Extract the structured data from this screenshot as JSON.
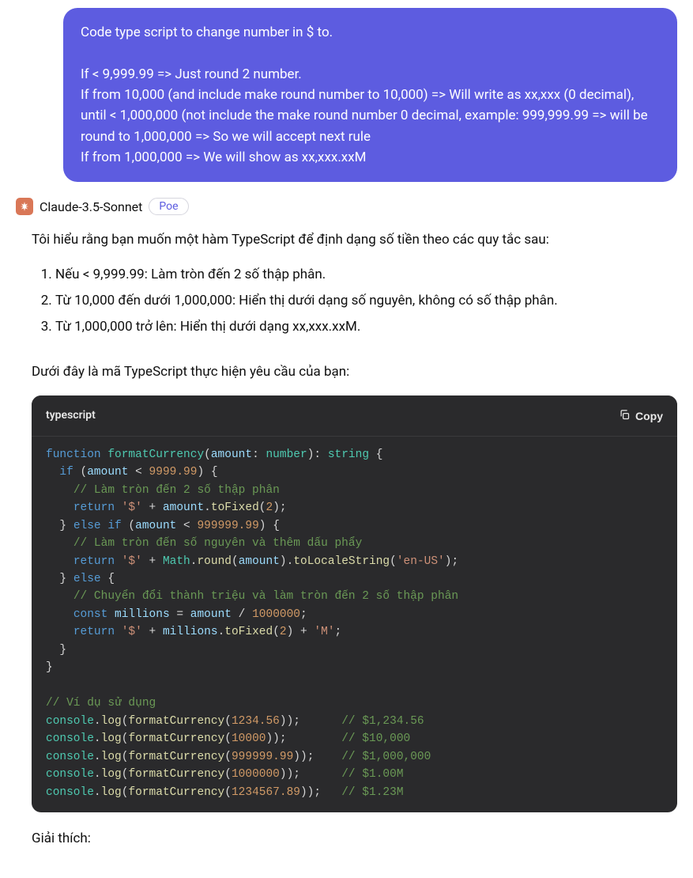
{
  "user_message": {
    "line1": "Code type script to change number in $ to.",
    "blank": "",
    "line2": "If < 9,999.99 => Just round 2 number.",
    "line3": "If from 10,000 (and include make round number to 10,000) => Will write as xx,xxx (0 decimal), until < 1,000,000 (not include the make round number 0 decimal, example: 999,999.99 => will be round to 1,000,000 => So we will accept next rule",
    "line4": "If from 1,000,000 => We will show as xx,xxx.xxM"
  },
  "bot": {
    "name": "Claude-3.5-Sonnet",
    "platform": "Poe"
  },
  "response": {
    "intro": "Tôi hiểu rằng bạn muốn một hàm TypeScript để định dạng số tiền theo các quy tắc sau:",
    "rules": [
      "Nếu < 9,999.99: Làm tròn đến 2 số thập phân.",
      "Từ 10,000 đến dưới 1,000,000: Hiển thị dưới dạng số nguyên, không có số thập phân.",
      "Từ 1,000,000 trở lên: Hiển thị dưới dạng xx,xxx.xxM."
    ],
    "code_intro": "Dưới đây là mã TypeScript thực hiện yêu cầu của bạn:",
    "outro": "Giải thích:"
  },
  "code": {
    "language": "typescript",
    "copy_label": "Copy",
    "tokens": {
      "kw_function": "function",
      "fn_name": "formatCurrency",
      "param": "amount",
      "typ_number": "number",
      "typ_string": "string",
      "kw_if": "if",
      "num_999999_1": "9999.99",
      "com1": "// Làm tròn đến 2 số thập phân",
      "kw_return": "return",
      "str_dollar": "'$'",
      "call_toFixed": "toFixed",
      "num_2": "2",
      "kw_elseif": "else if",
      "num_999999_99": "999999.99",
      "com2": "// Làm tròn đến số nguyên và thêm dấu phẩy",
      "obj_Math": "Math",
      "call_round": "round",
      "call_toLocale": "toLocaleString",
      "str_enus": "'en-US'",
      "kw_else": "else",
      "com3": "// Chuyển đổi thành triệu và làm tròn đến 2 số thập phân",
      "kw_const": "const",
      "var_millions": "millions",
      "num_million": "1000000",
      "str_M": "'M'",
      "com_vd": "// Ví dụ sử dụng",
      "obj_console": "console",
      "call_log": "log",
      "num_ex1": "1234.56",
      "com_ex1": "// $1,234.56",
      "num_ex2": "10000",
      "com_ex2": "// $10,000",
      "num_ex3": "999999.99",
      "com_ex3": "// $1,000,000",
      "num_ex4": "1000000",
      "com_ex4": "// $1.00M",
      "num_ex5": "1234567.89",
      "com_ex5": "// $1.23M"
    }
  }
}
